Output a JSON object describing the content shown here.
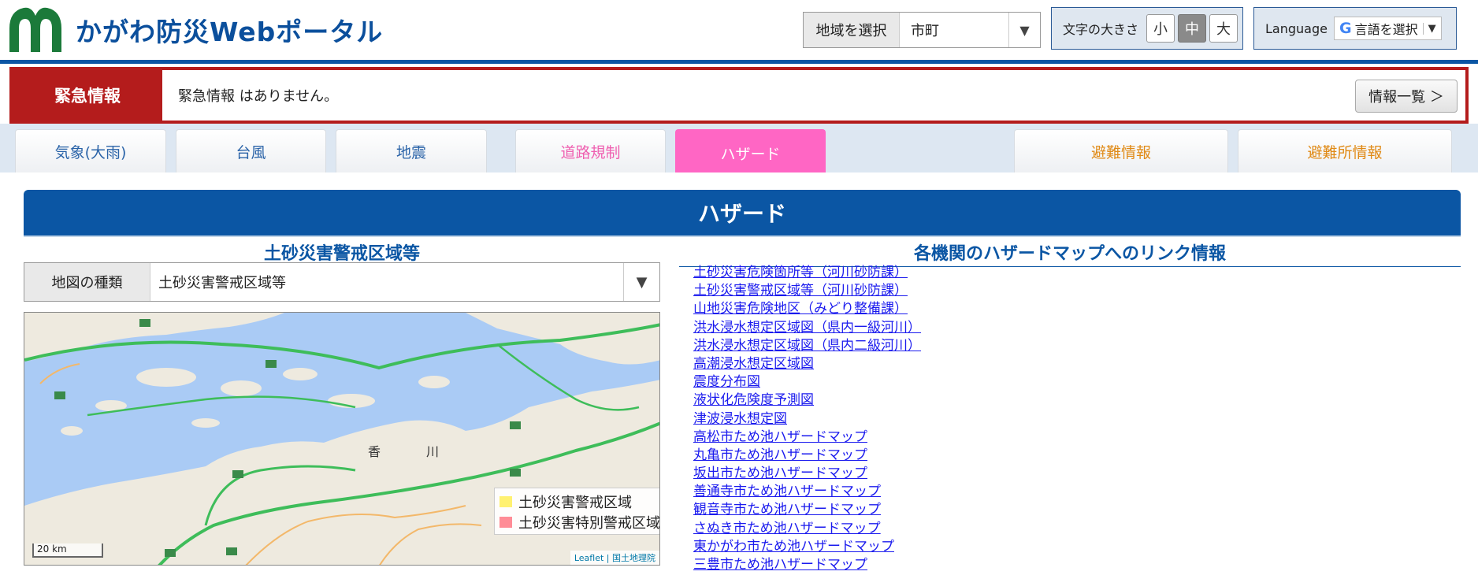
{
  "header": {
    "site_title": "かがわ防災Webポータル",
    "region_label": "地域を選択",
    "region_value": "市町",
    "fontsize_label": "文字の大きさ",
    "fontsize_options": [
      "小",
      "中",
      "大"
    ],
    "fontsize_selected": "中",
    "language_label": "Language",
    "language_select": "言語を選択"
  },
  "emergency": {
    "label": "緊急情報",
    "message": "緊急情報 はありません。",
    "list_button": "情報一覧 ＞"
  },
  "tabs": [
    {
      "label": "気象(大雨)",
      "color": "#2a63a8"
    },
    {
      "label": "台風",
      "color": "#2a63a8"
    },
    {
      "label": "地震",
      "color": "#2a63a8"
    },
    {
      "label": "道路規制",
      "color": "#ef5fb0"
    },
    {
      "label": "ハザード",
      "color": "#ff66c4",
      "active": true
    },
    {
      "label": "避難情報",
      "color": "#e08a16"
    },
    {
      "label": "避難所情報",
      "color": "#e08a16"
    }
  ],
  "section": {
    "title": "ハザード"
  },
  "left": {
    "title": "土砂災害警戒区域等",
    "map_type_label": "地図の種類",
    "map_type_value": "土砂災害警戒区域等",
    "map_labels": [
      "香",
      "川"
    ],
    "legend": [
      {
        "label": "土砂災害警戒区域",
        "color": "#fff170"
      },
      {
        "label": "土砂災害特別警戒区域",
        "color": "#ff8c96"
      }
    ],
    "scale": "20 km",
    "attribution": "Leaflet | 国土地理院"
  },
  "right": {
    "title": "各機関のハザードマップへのリンク情報",
    "links": [
      "土砂災害危険箇所等（河川砂防課）",
      "土砂災害警戒区域等（河川砂防課）",
      "山地災害危険地区（みどり整備課）",
      "洪水浸水想定区域図（県内一級河川）",
      "洪水浸水想定区域図（県内二級河川）",
      "高潮浸水想定区域図",
      "震度分布図",
      "液状化危険度予測図",
      "津波浸水想定図",
      "高松市ため池ハザードマップ",
      "丸亀市ため池ハザードマップ",
      "坂出市ため池ハザードマップ",
      "善通寺市ため池ハザードマップ",
      "観音寺市ため池ハザードマップ",
      "さぬき市ため池ハザードマップ",
      "東かがわ市ため池ハザードマップ",
      "三豊市ため池ハザードマップ"
    ]
  }
}
